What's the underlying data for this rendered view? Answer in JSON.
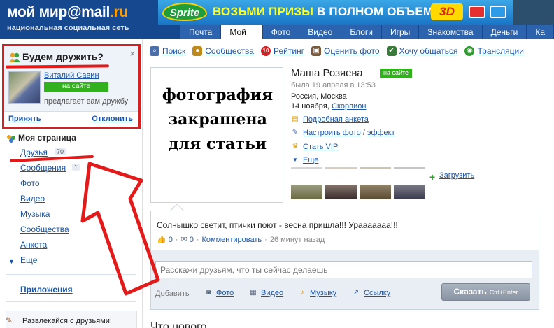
{
  "header": {
    "logo_main": "мой мир@mail",
    "logo_ru": ".ru",
    "tagline": "национальная социальная сеть",
    "banner": {
      "brand": "Sprite",
      "text_yellow": "ВОЗЬМИ ПРИЗЫ",
      "text_white": " В ПОЛНОМ ОБЪЕМЕ!",
      "badge": "3D"
    },
    "tabs": [
      "Почта",
      "Мой мир",
      "Фото",
      "Видео",
      "Блоги",
      "Игры",
      "Знакомства",
      "Деньги",
      "Ка"
    ]
  },
  "friend_box": {
    "title": "Будем дружить?",
    "close": "×",
    "name": "Виталий Савин",
    "online": "на сайте",
    "offer": "предлагает вам дружбу",
    "accept": "Принять",
    "decline": "Отклонить"
  },
  "nav": {
    "my_page": "Моя страница",
    "items": [
      {
        "label": "Друзья",
        "count": "70"
      },
      {
        "label": "Сообщения",
        "count": "1"
      },
      {
        "label": "Фото"
      },
      {
        "label": "Видео"
      },
      {
        "label": "Музыка"
      },
      {
        "label": "Сообщества"
      },
      {
        "label": "Анкета"
      },
      {
        "label": "Еще"
      }
    ],
    "apps": "Приложения",
    "fun": "Развлекайся с друзьями!"
  },
  "toplinks": [
    {
      "label": "Поиск",
      "icon": "search-icon",
      "color": "#4a6fa8"
    },
    {
      "label": "Сообщества",
      "icon": "community-icon",
      "color": "#c08a1a"
    },
    {
      "label": "Рейтинг",
      "icon": "rating-icon",
      "color": "#d42020",
      "badge": "10"
    },
    {
      "label": "Оценить фото",
      "icon": "rate-photo-icon",
      "color": "#7a5a3a"
    },
    {
      "label": "Хочу общаться",
      "icon": "chat-icon",
      "color": "#3a7a3a"
    },
    {
      "label": "Трансляции",
      "icon": "broadcast-icon",
      "color": "#2a9d2a"
    }
  ],
  "profile": {
    "photo_caption": "фотография закрашена для статьи",
    "name": "Маша Розяева",
    "online": "на сайте",
    "last_seen": "была 19 апреля в 13:53",
    "city": "Россия, Москва",
    "birthday": "14 ноября,",
    "zodiac": "Скорпион",
    "actions": [
      {
        "label": "Подробная анкета"
      },
      {
        "label": "Настроить фото"
      },
      {
        "label": "эффект"
      },
      {
        "label": "Стать VIP"
      },
      {
        "label": "Еще"
      }
    ],
    "upload": "Загрузить"
  },
  "status": {
    "text": "Солнышко светит, птички поют - весна пришла!!! Урааааааа!!!",
    "likes": "0",
    "comments": "0",
    "comment_link": "Комментировать",
    "time": "26 минут назад",
    "input_placeholder": "Расскажи друзьям, что ты сейчас делаешь",
    "add": "Добавить",
    "attach": [
      "Фото",
      "Видео",
      "Музыку",
      "Ссылку"
    ],
    "submit": "Сказать",
    "submit_hint": "Ctrl+Enter"
  },
  "whats_new": "Что нового"
}
